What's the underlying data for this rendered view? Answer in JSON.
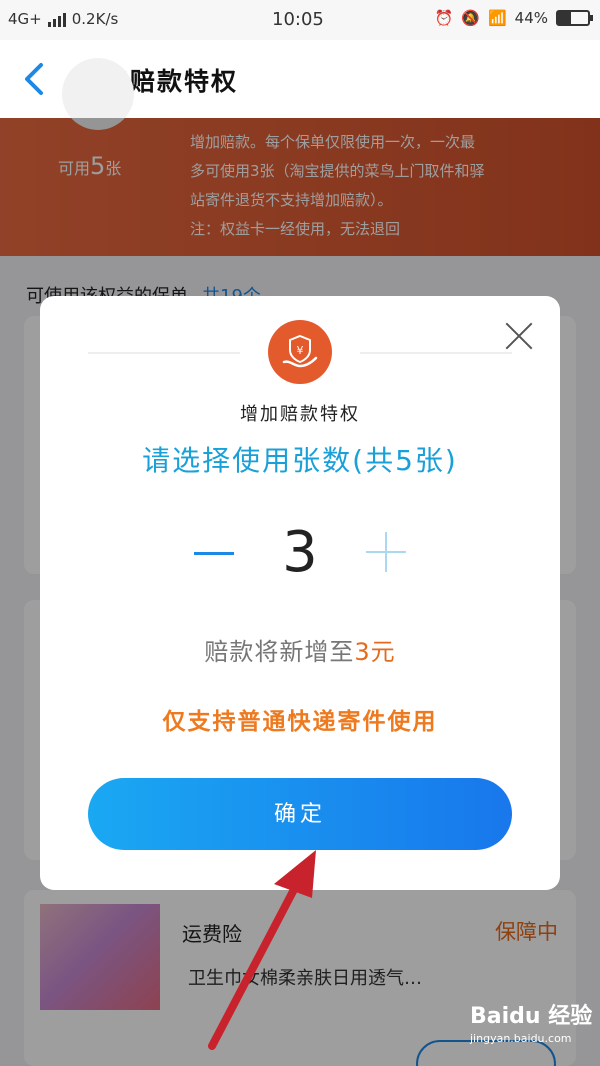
{
  "status_bar": {
    "network": "4G+",
    "speed": "0.2K/s",
    "time": "10:05",
    "battery": "44%",
    "battery_level": 0.44
  },
  "header": {
    "title": "增加赔款特权"
  },
  "banner": {
    "available_prefix": "可用",
    "available_count": "5",
    "available_suffix": "张",
    "line1": "增加赔款。每个保单仅限使用一次，一次最",
    "line2": "多可使用3张（淘宝提供的菜鸟上门取件和驿",
    "line3": "站寄件退货不支持增加赔款）。",
    "line4": "注：权益卡一经使用，无法退回"
  },
  "list": {
    "title": "可使用该权益的保单",
    "count": "共19个"
  },
  "product": {
    "name": "运费险",
    "status": "保障中",
    "desc": "卫生巾女棉柔亲肤日用透气…"
  },
  "modal": {
    "subtitle": "增加赔款特权",
    "heading": "请选择使用张数(共5张)",
    "quantity": "3",
    "payout_prefix": "赔款将新增至",
    "payout_amount": "3元",
    "notice": "仅支持普通快递寄件使用",
    "confirm_label": "确定"
  },
  "watermark": {
    "brand": "Baidu 经验",
    "url": "jingyan.baidu.com"
  },
  "colors": {
    "accent": "#1e88e5",
    "banner": "#e0603a",
    "notice": "#ee7a20",
    "heading": "#1aa0d8"
  }
}
